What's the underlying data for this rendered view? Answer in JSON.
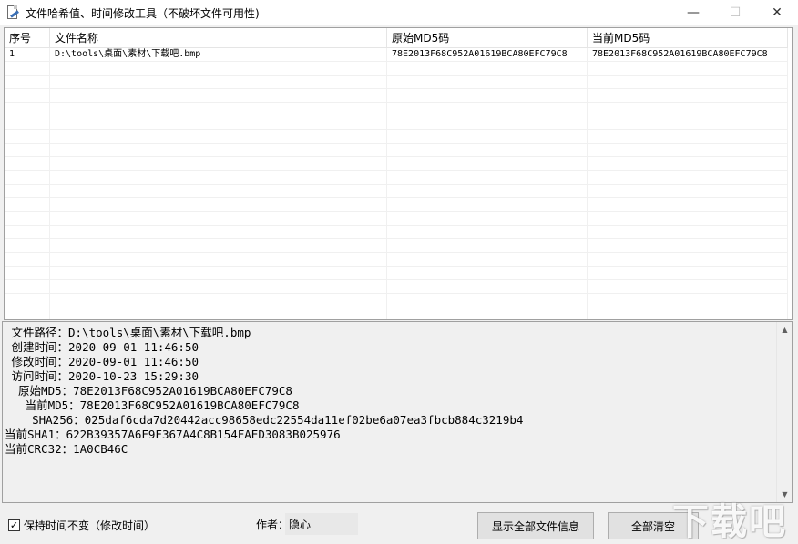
{
  "window": {
    "title": "文件哈希值、时间修改工具（不破坏文件可用性)",
    "icon": "file-edit-icon",
    "controls": {
      "minimize": "—",
      "maximize": "☐",
      "close": "✕"
    }
  },
  "table": {
    "columns": [
      "序号",
      "文件名称",
      "原始MD5码",
      "当前MD5码"
    ],
    "rows": [
      {
        "index": "1",
        "name": "D:\\tools\\桌面\\素材\\下载吧.bmp",
        "orig_md5": "78E2013F68C952A01619BCA80EFC79C8",
        "cur_md5": "78E2013F68C952A01619BCA80EFC79C8"
      }
    ]
  },
  "info": {
    "path": " 文件路径：D:\\tools\\桌面\\素材\\下载吧.bmp",
    "created": " 创建时间：2020-09-01 11:46:50",
    "modified": " 修改时间：2020-09-01 11:46:50",
    "accessed": " 访问时间：2020-10-23 15:29:30",
    "orig_md5": "  原始MD5：78E2013F68C952A01619BCA80EFC79C8",
    "cur_md5": "   当前MD5：78E2013F68C952A01619BCA80EFC79C8",
    "sha256": "    SHA256：025daf6cda7d20442acc98658edc22554da11ef02be6a07ea3fbcb884c3219b4",
    "sha1": "当前SHA1：622B39357A6F9F367A4C8B154FAED3083B025976",
    "crc32": "当前CRC32：1A0CB46C"
  },
  "bottom": {
    "keep_time_checked": true,
    "check_mark": "✓",
    "keep_time_label": "保持时间不变（修改时间）",
    "author_label": "作者：",
    "author_value": "隐心",
    "show_all_button": "显示全部文件信息",
    "clear_all_button": "全部清空"
  },
  "watermark": "下载吧"
}
